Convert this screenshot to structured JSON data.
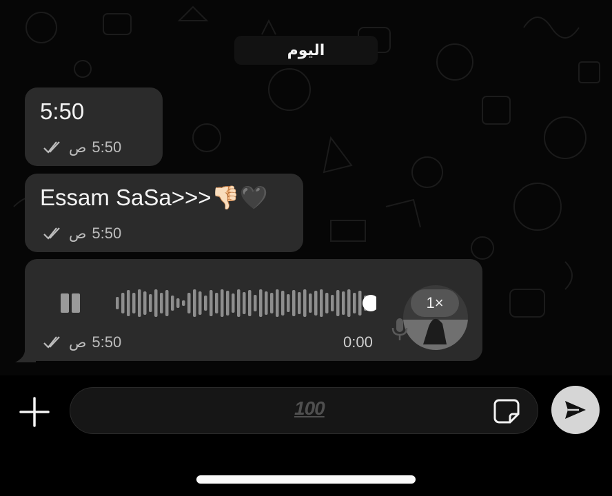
{
  "date_separator": "اليوم",
  "messages": [
    {
      "text": "5:50",
      "time": "5:50",
      "ampm": "ص"
    },
    {
      "text": "Essam SaSa>>>👎🏻🖤",
      "time": "5:50",
      "ampm": "ص"
    }
  ],
  "voice_message": {
    "time": "5:50",
    "ampm": "ص",
    "duration": "0:00",
    "speed": "1×",
    "progress": 1.0
  },
  "composer": {
    "placeholder_emoji": "100"
  },
  "colors": {
    "background": "#060606",
    "bubble": "#2b2b2b",
    "send_button": "#d6d6d6"
  },
  "icons": [
    "double-check-icon",
    "pause-icon",
    "mic-icon",
    "plus-icon",
    "hundred-points-icon",
    "sticker-icon",
    "send-icon"
  ]
}
